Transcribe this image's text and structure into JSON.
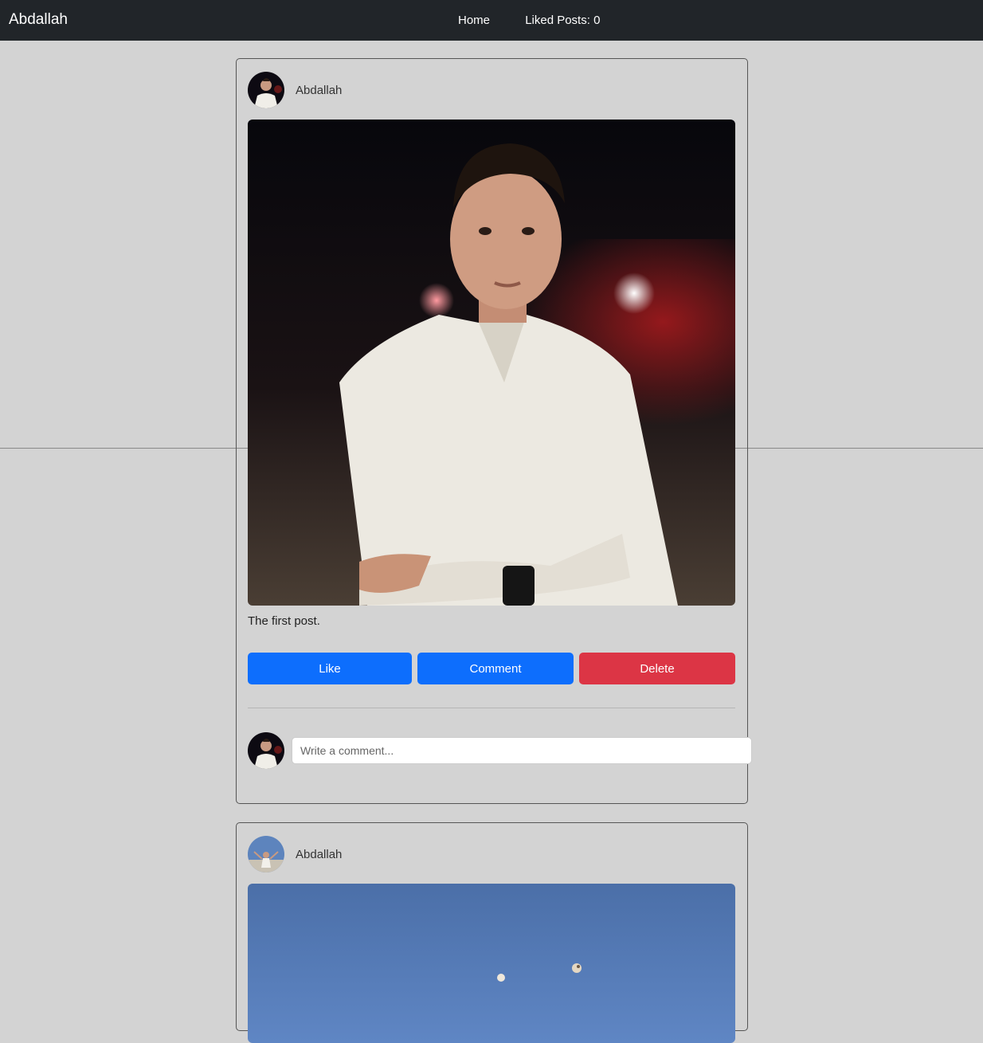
{
  "navbar": {
    "brand": "Abdallah",
    "links": [
      {
        "label": "Home"
      },
      {
        "label": "Liked Posts: 0"
      }
    ]
  },
  "posts": [
    {
      "author": "Abdallah",
      "caption": "The first post.",
      "like_label": "Like",
      "comment_label": "Comment",
      "delete_label": "Delete",
      "comment_placeholder": "Write a comment..."
    },
    {
      "author": "Abdallah"
    }
  ],
  "colors": {
    "navbar_bg": "#212529",
    "page_bg": "#d3d3d3",
    "primary": "#0d6efd",
    "danger": "#dc3545"
  }
}
